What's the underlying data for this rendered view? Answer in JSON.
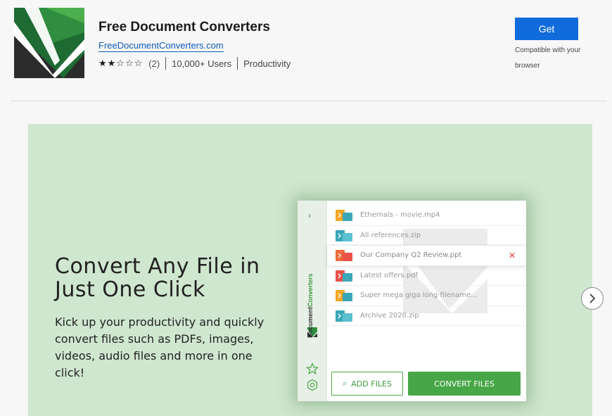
{
  "extension": {
    "name": "Free Document Converters",
    "website": "FreeDocumentConverters.com",
    "stars_display": "★★☆☆☆",
    "rating_count": "(2)",
    "users": "10,000+ Users",
    "category": "Productivity"
  },
  "get_button": {
    "label": "Get",
    "compat_note": "Compatible with your browser"
  },
  "banner": {
    "headline": "Convert Any File in Just One Click",
    "blurb": "Kick up your productivity and quickly convert files such as PDFs, images, videos, audio files and more in one click!",
    "app": {
      "brand_word1": "Document",
      "brand_word2": "Converters",
      "files": [
        {
          "name": "Ethernals - movie.mp4",
          "color": "#f5a623"
        },
        {
          "name": "All references.zip",
          "color": "#3aa7b8"
        },
        {
          "name": "Our Company Q2 Review.ppt",
          "color": "#ef6a3a",
          "active": true
        },
        {
          "name": "Latest offers.pdf",
          "color": "#e8514a"
        },
        {
          "name": "Super mega giga long filename...",
          "color": "#f5a623"
        },
        {
          "name": "Archive 2020.zip",
          "color": "#3aa7b8"
        }
      ],
      "remove_glyph": "✕",
      "add_files_label": "ADD FILES",
      "convert_label": "CONVERT FILES"
    }
  },
  "colors": {
    "accent": "#0f6cda",
    "brand_green": "#47a747",
    "banner_bg": "#cfe6cf"
  },
  "icons": [
    "logo",
    "star-icon",
    "gear-icon",
    "paperclip-icon",
    "chevron-right-icon",
    "remove-icon"
  ]
}
